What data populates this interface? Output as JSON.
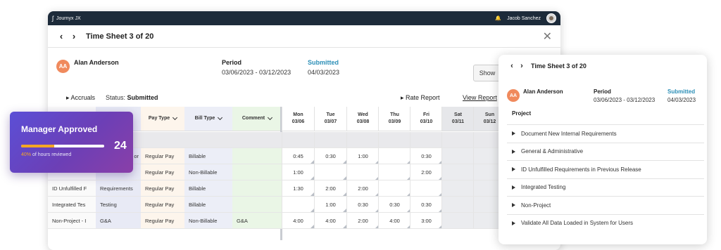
{
  "app": {
    "name": "Journyx JX",
    "user": "Jacob Sanchez"
  },
  "header": {
    "title": "Time Sheet 3 of 20"
  },
  "employee": {
    "initials": "AA",
    "name": "Alan Anderson"
  },
  "period": {
    "label": "Period",
    "value": "03/06/2023 - 03/12/2023"
  },
  "status": {
    "label": "Submitted",
    "date": "04/03/2023",
    "status_label": "Status:",
    "status_value": "Submitted"
  },
  "toolbar": {
    "accruals": "Accruals",
    "rate_report": "Rate Report",
    "view_report": "View Report",
    "show": "Show"
  },
  "columns": {
    "pay_type": "Pay Type",
    "bill_type": "Bill Type",
    "comment": "Comment",
    "days": [
      {
        "day": "Mon",
        "date": "03/06"
      },
      {
        "day": "Tue",
        "date": "03/07"
      },
      {
        "day": "Wed",
        "date": "03/08"
      },
      {
        "day": "Thu",
        "date": "03/09"
      },
      {
        "day": "Fri",
        "date": "03/10"
      },
      {
        "day": "Sat",
        "date": "03/11"
      },
      {
        "day": "Sun",
        "date": "03/12"
      }
    ]
  },
  "rows": [
    {
      "project": "",
      "task": "",
      "pay": "",
      "bill": "",
      "comment": "",
      "hours": [
        "",
        "",
        "",
        "",
        "",
        "",
        ""
      ]
    },
    {
      "project": "",
      "task": "or",
      "pay": "Regular Pay",
      "bill": "Billable",
      "comment": "",
      "hours": [
        "0:45",
        "0:30",
        "1:00",
        "",
        "0:30",
        "",
        ""
      ]
    },
    {
      "project": "",
      "task": "",
      "pay": "Regular Pay",
      "bill": "Non-Billable",
      "comment": "",
      "hours": [
        "1:00",
        "",
        "",
        "",
        "2:00",
        "",
        ""
      ]
    },
    {
      "project": "ID Unfulfilled F",
      "task": "Requirements",
      "pay": "Regular Pay",
      "bill": "Billable",
      "comment": "",
      "hours": [
        "1:30",
        "2:00",
        "2:00",
        "",
        "",
        "",
        ""
      ]
    },
    {
      "project": "Integrated Tes",
      "task": "Testing",
      "pay": "Regular Pay",
      "bill": "Billable",
      "comment": "",
      "hours": [
        "",
        "1:00",
        "0:30",
        "0:30",
        "0:30",
        "",
        ""
      ]
    },
    {
      "project": "Non-Project - I",
      "task": "G&A",
      "pay": "Regular Pay",
      "bill": "Non-Billable",
      "comment": "G&A",
      "hours": [
        "4:00",
        "4:00",
        "2:00",
        "4:00",
        "3:00",
        "",
        ""
      ]
    }
  ],
  "manager_card": {
    "title": "Manager Approved",
    "count": "24",
    "progress_pct": 40,
    "progress_text": "40%",
    "subtitle_suffix": " of hours reviewed"
  },
  "side_panel": {
    "title": "Time Sheet 3 of 20",
    "project_header": "Project",
    "projects": [
      "Document New Internal Requirements",
      "General & Administrative",
      "ID Unfulfilled Requirements in Previous Release",
      "Integrated Testing",
      "Non-Project",
      "Validate All Data Loaded in System for Users"
    ]
  },
  "colors": {
    "accent": "#2c8fb7",
    "card_start": "#5b4fd6",
    "card_end": "#8a3fa8",
    "progress": "#f5a623",
    "avatar": "#f08a5d"
  }
}
